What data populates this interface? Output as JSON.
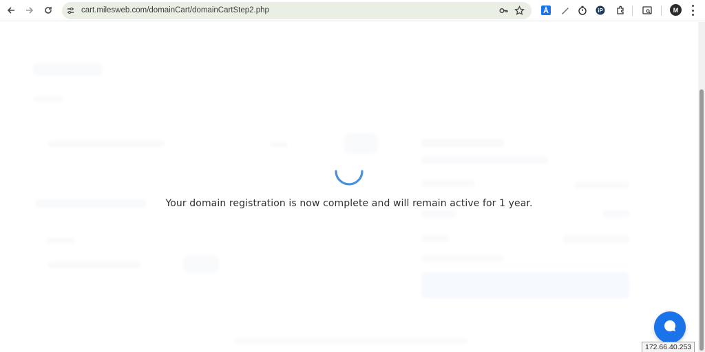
{
  "browser": {
    "url": "cart.milesweb.com/domainCart/domainCartStep2.php",
    "profile_initial": "M",
    "icons": {
      "back": "back-arrow-icon",
      "forward": "forward-arrow-icon",
      "reload": "reload-icon",
      "site_info": "tune-icon",
      "password": "key-icon",
      "bookmark": "star-icon",
      "extensions": [
        "extension-a-icon",
        "pen-icon",
        "timer-icon",
        "p-extension-icon",
        "puzzle-icon",
        "tab-search-icon"
      ],
      "menu": "more-vert-icon"
    }
  },
  "loader": {
    "message": "Your domain registration is now complete and will remain active for 1 year."
  },
  "chat": {
    "icon": "chat-bubble-icon",
    "color": "#1a73e8"
  },
  "status": {
    "ip": "172.66.40.253"
  },
  "colors": {
    "accent": "#1a73e8",
    "spinner": "#4a90d9",
    "omnibox": "#e9efe4"
  }
}
